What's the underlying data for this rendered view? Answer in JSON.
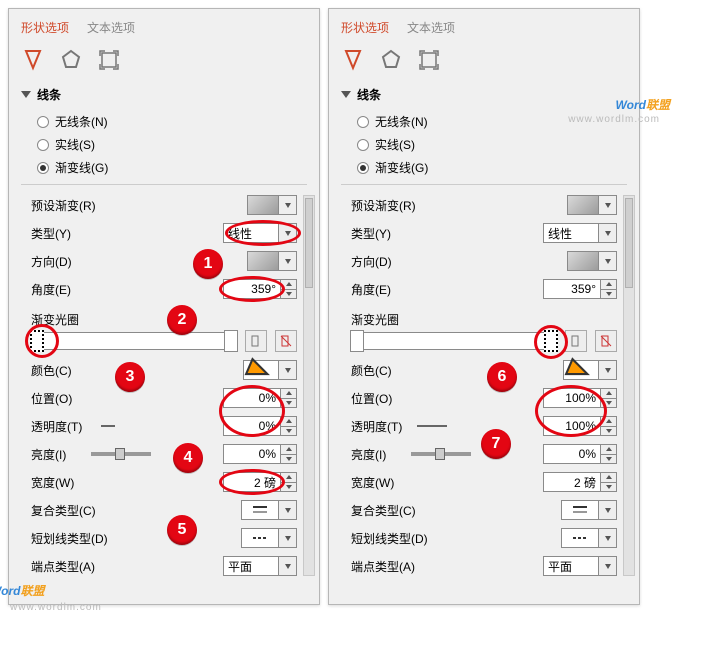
{
  "tabs": {
    "shape": "形状选项",
    "text": "文本选项"
  },
  "section": {
    "line": "线条"
  },
  "radio": {
    "noline": "无线条(N)",
    "solid": "实线(S)",
    "gradient": "渐变线(G)"
  },
  "labels": {
    "preset": "预设渐变(R)",
    "type": "类型(Y)",
    "direction": "方向(D)",
    "angle": "角度(E)",
    "gradstops": "渐变光圈",
    "color": "颜色(C)",
    "position": "位置(O)",
    "transparency": "透明度(T)",
    "brightness": "亮度(I)",
    "width": "宽度(W)",
    "compound": "复合类型(C)",
    "dash": "短划线类型(D)",
    "cap": "端点类型(A)"
  },
  "left": {
    "type": "线性",
    "angle": "359°",
    "position": "0%",
    "transparency": "0%",
    "brightness": "0%",
    "width": "2 磅",
    "cap": "平面"
  },
  "right": {
    "type": "线性",
    "angle": "359°",
    "position": "100%",
    "transparency": "100%",
    "brightness": "0%",
    "width": "2 磅",
    "cap": "平面"
  },
  "watermark": {
    "text1": "Word",
    "text2": "联盟",
    "url": "www.wordlm.com"
  },
  "badges": {
    "b1": "1",
    "b2": "2",
    "b3": "3",
    "b4": "4",
    "b5": "5",
    "b6": "6",
    "b7": "7"
  }
}
